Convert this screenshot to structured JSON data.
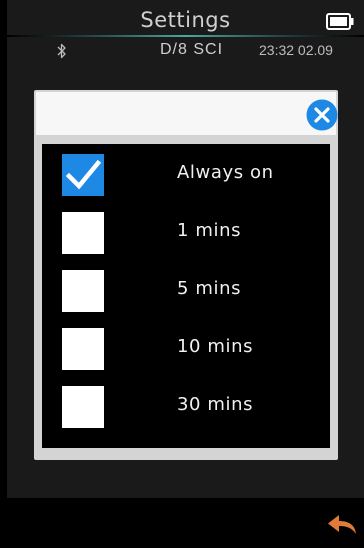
{
  "header": {
    "title": "Settings",
    "mode": "D/8  SCI",
    "clock": "23:32 02.09"
  },
  "options": [
    {
      "label": "Always on",
      "checked": true
    },
    {
      "label": "1 mins",
      "checked": false
    },
    {
      "label": "5 mins",
      "checked": false
    },
    {
      "label": "10 mins",
      "checked": false
    },
    {
      "label": "30 mins",
      "checked": false
    }
  ],
  "icons": {
    "battery": "battery-icon",
    "bluetooth": "bluetooth-icon",
    "close": "close-icon",
    "back": "back-arrow-icon",
    "check": "checkmark-icon"
  },
  "colors": {
    "accent_blue": "#1e88e5",
    "back_orange": "#e07b39",
    "background": "#1a1a1a"
  }
}
